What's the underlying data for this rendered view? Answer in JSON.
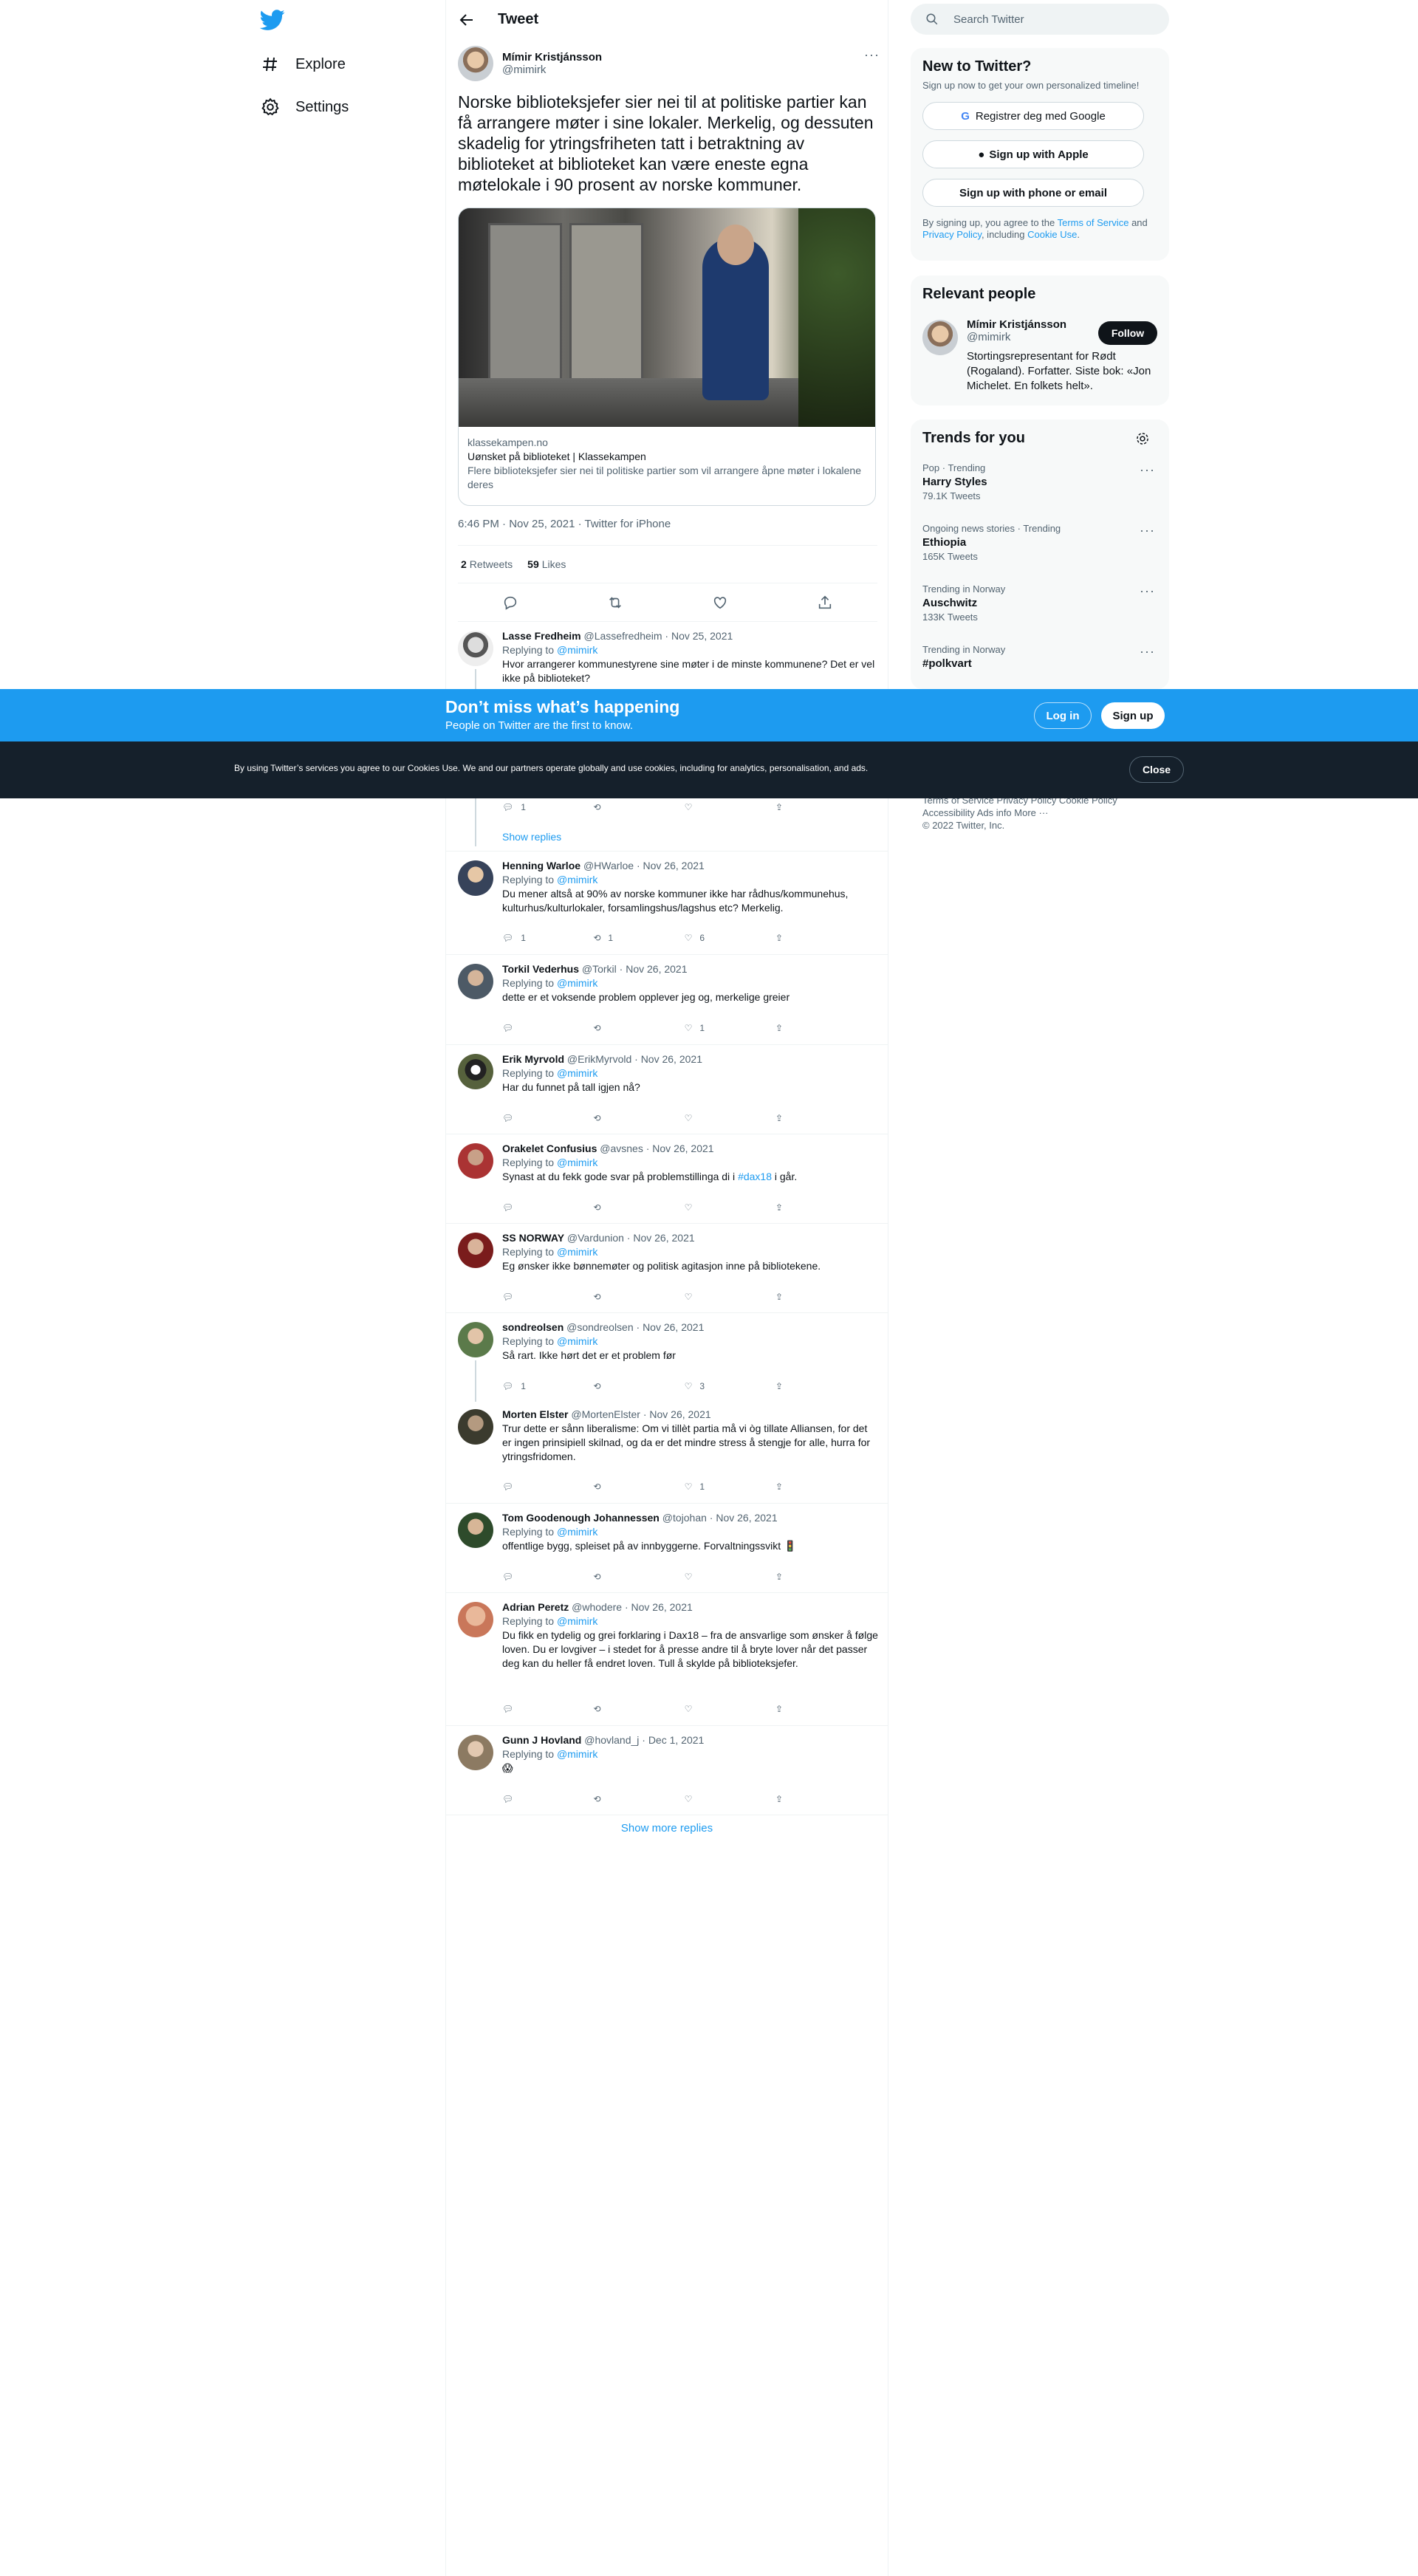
{
  "nav": {
    "explore": "Explore",
    "settings": "Settings"
  },
  "header": {
    "title": "Tweet"
  },
  "tweet": {
    "name": "Mímir Kristjánsson",
    "handle": "@mimirk",
    "text": "Norske biblioteksjefer sier nei til at politiske partier kan få arrangere møter i sine lokaler. Merkelig, og dessuten skadelig for ytringsfriheten tatt i betraktning av biblioteket at biblioteket kan være eneste egna møtelokale i 90 prosent av norske kommuner.",
    "card": {
      "domain": "klassekampen.no",
      "title": "Uønsket på biblioteket | Klassekampen",
      "desc": "Flere biblioteksjefer sier nei til politiske partier som vil arrangere åpne møter i lokalene deres"
    },
    "time": "6:46 PM · Nov 25, 2021 · Twitter for iPhone",
    "retweets": "2",
    "retweets_label": "Retweets",
    "likes": "59",
    "likes_label": "Likes"
  },
  "replying_to": "Replying to",
  "replies": [
    {
      "name": "Lasse Fredheim",
      "meta": "@Lassefredheim · Nov 25, 2021",
      "mention": "@mimirk",
      "text": "Hvor arrangerer kommunestyrene sine møter i de minste kommunene? Det er vel ikke på biblioteket?",
      "c": "1",
      "r": "",
      "l": ""
    },
    {
      "name": "Henning Warloe",
      "meta": "@HWarloe · Nov 26, 2021",
      "mention": "@mimirk",
      "text": "Du mener altså at 90% av norske kommuner ikke har rådhus/kommunehus, kulturhus/kulturlokaler, forsamlingshus/lagshus etc? Merkelig.",
      "c": "1",
      "r": "1",
      "l": "6"
    },
    {
      "name": "Torkil Vederhus",
      "meta": "@Torkil · Nov 26, 2021",
      "mention": "@mimirk",
      "text": "dette er et voksende problem opplever jeg og, merkelige greier",
      "c": "",
      "r": "",
      "l": "1"
    },
    {
      "name": "Erik Myrvold",
      "meta": "@ErikMyrvold · Nov 26, 2021",
      "mention": "@mimirk",
      "text": "Har du funnet på tall igjen nå?",
      "c": "",
      "r": "",
      "l": ""
    },
    {
      "name": "Orakelet Confusius",
      "meta": "@avsnes · Nov 26, 2021",
      "mention": "@mimirk",
      "text": "Synast at du fekk gode svar på problemstillinga di i ",
      "tag": "#dax18",
      "text2": " i går.",
      "c": "",
      "r": "",
      "l": ""
    },
    {
      "name": "SS NORWAY",
      "meta": "@Vardunion · Nov 26, 2021",
      "mention": "@mimirk",
      "text": "Eg ønsker ikke bønnemøter og politisk agitasjon inne på bibliotekene.",
      "c": "",
      "r": "",
      "l": ""
    },
    {
      "name": "sondreolsen",
      "meta": "@sondreolsen · Nov 26, 2021",
      "mention": "@mimirk",
      "text": "Så rart. Ikke hørt det er et problem før",
      "c": "1",
      "r": "",
      "l": "3"
    },
    {
      "name": "Morten Elster",
      "meta": "@MortenElster · Nov 26, 2021",
      "mention": "",
      "text": "Trur dette er sånn liberalisme: Om vi tillèt partia må vi òg tillate Alliansen, for det er ingen prinsipiell skilnad, og da er det mindre stress å stengje for alle, hurra for ytringsfridomen.",
      "c": "",
      "r": "",
      "l": "1"
    },
    {
      "name": "Tom Goodenough Johannessen",
      "meta": "@tojohan · Nov 26, 2021",
      "mention": "@mimirk",
      "text": "offentlige bygg, spleiset på av innbyggerne. Forvaltningssvikt 🚦",
      "c": "",
      "r": "",
      "l": ""
    },
    {
      "name": "Adrian Peretz",
      "meta": "@whodere · Nov 26, 2021",
      "mention": "@mimirk",
      "text": "Du fikk en tydelig og grei forklaring i Dax18 – fra de ansvarlige som ønsker å følge loven. Du er lovgiver – i stedet for å presse andre til å bryte lover når det passer deg kan du heller få endret loven. Tull å skylde på biblioteksjefer.",
      "c": "",
      "r": "",
      "l": ""
    },
    {
      "name": "Gunn J Hovland",
      "meta": "@hovland_j · Dec 1, 2021",
      "mention": "@mimirk",
      "text": "😱",
      "c": "",
      "r": "",
      "l": ""
    }
  ],
  "show_replies": "Show replies",
  "show_more_replies": "Show more replies",
  "search": {
    "placeholder": "Search Twitter"
  },
  "new_to_twitter": {
    "title": "New to Twitter?",
    "sub": "Sign up now to get your own personalized timeline!",
    "google": "Registrer deg med Google",
    "apple": "Sign up with Apple",
    "phone": "Sign up with phone or email",
    "legal_1": "By signing up, you agree to the",
    "tos": "Terms of Service",
    "legal_2": "and",
    "privacy": "Privacy Policy",
    "legal_3": ", including",
    "cookie": "Cookie Use",
    "legal_4": "."
  },
  "relevant": {
    "title": "Relevant people",
    "name": "Mímir Kristjánsson",
    "handle": "@mimirk",
    "follow": "Follow",
    "bio": "Stortingsrepresentant for Rødt (Rogaland). Forfatter. Siste bok: «Jon Michelet. En folkets helt»."
  },
  "trends": {
    "title": "Trends for you",
    "items": [
      {
        "context": "Pop · Trending",
        "name": "Harry Styles",
        "count": "79.1K Tweets"
      },
      {
        "context": "Ongoing news stories · Trending",
        "name": "Ethiopia",
        "count": "165K Tweets"
      },
      {
        "context": "Trending in Norway",
        "name": "Auschwitz",
        "count": "133K Tweets"
      },
      {
        "context": "Trending in Norway",
        "name": "#polkvart",
        "count": ""
      }
    ]
  },
  "footer": {
    "line1": "Terms of Service   Privacy Policy   Cookie Policy",
    "line2": "Accessibility   Ads info   More ···",
    "line3": "© 2022 Twitter, Inc."
  },
  "banner": {
    "title": "Don’t miss what’s happening",
    "sub": "People on Twitter are the first to know.",
    "login": "Log in",
    "signup": "Sign up"
  },
  "cookie": {
    "message": "By using Twitter’s services you agree to our Cookies Use. We and our partners operate globally and use cookies, including for analytics, personalisation, and ads.",
    "close": "Close"
  },
  "colors": {
    "accent": "#1d9bf0",
    "banner": "#1d9bf0",
    "cookie_bg": "#15202b"
  }
}
